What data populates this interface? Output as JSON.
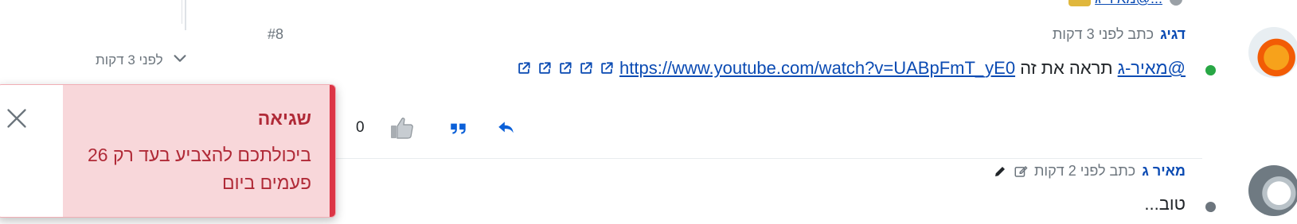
{
  "top_row": {
    "text": "...@מאיר-ג"
  },
  "timeline": {
    "post_index": "#8",
    "time_label": "לפני 3 דקות"
  },
  "post1": {
    "author": "דגיג",
    "time": "כתב לפני 3 דקות",
    "mention": "@מאיר-ג",
    "text": "תראה את זה",
    "link": "https://www.youtube.com/watch?v=UABpFmT_yE0",
    "vote_count": "0"
  },
  "post2": {
    "author": "מאיר ג",
    "time": "כתב לפני 2 דקות",
    "text": "טוב..."
  },
  "toast": {
    "title": "שגיאה",
    "message": "ביכולתכם להצביע בעד רק 26 פעמים ביום"
  },
  "colors": {
    "accent": "#0b4bb3",
    "online": "#28a745",
    "error_text": "#b02a37",
    "error_bg": "#f8d7da",
    "error_bar": "#dc3545"
  },
  "icons": [
    "chevron-down-icon",
    "external-link-icon",
    "thumbs-up-icon",
    "quote-icon",
    "reply-icon",
    "edit-icon",
    "pencil-icon",
    "close-icon"
  ]
}
